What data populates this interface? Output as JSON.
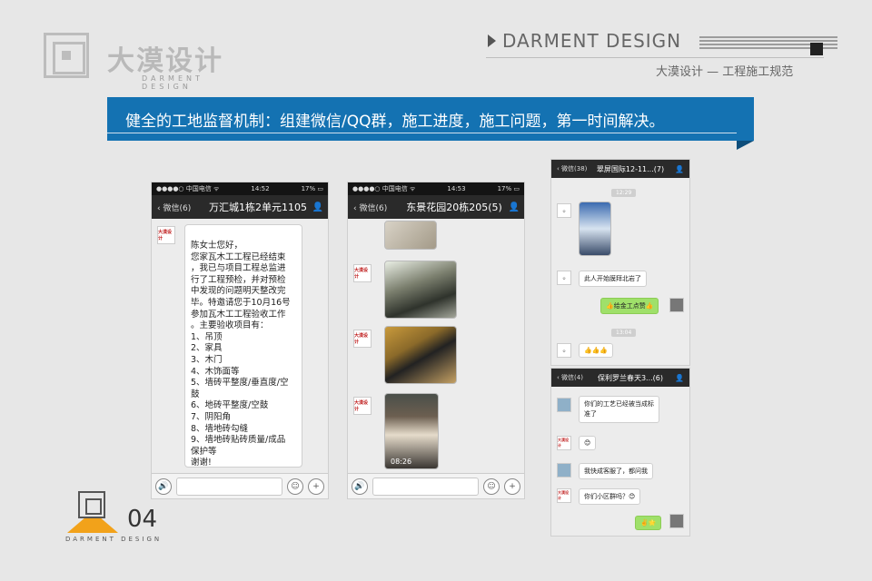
{
  "header": {
    "logo_cn": "大漠设计",
    "logo_en": "DARMENT DESIGN",
    "brand": "DARMENT  DESIGN",
    "subtitle": "大漠设计 — 工程施工规范"
  },
  "banner": {
    "text": "健全的工地监督机制：组建微信/QQ群，施工进度，施工问题，第一时间解决。"
  },
  "phone1": {
    "status": {
      "carrier": "●●●●○ 中国电信 ᯤ",
      "time": "14:52",
      "battery": "17% ▭"
    },
    "back": "微信(6)",
    "title": "万汇城1栋2单元1105",
    "avatar": "大漠设计",
    "message": [
      "陈女士您好，",
      "您家瓦木工工程已经结束",
      "，我已与项目工程总监进",
      "行了工程预检，并对预检",
      "中发现的问题明天整改完",
      "毕。特邀请您于10月16号",
      "参加瓦木工工程验收工作",
      "。主要验收项目有：",
      "1、吊顶",
      "2、家具",
      "3、木门",
      "4、木饰面等",
      "5、墙砖平整度/垂直度/空",
      "鼓",
      "6、地砖平整度/空鼓",
      "7、阴阳角",
      "8、墙地砖勾缝",
      "9、墙地砖贴砖质量/成品",
      "保护等",
      "谢谢!"
    ]
  },
  "phone2": {
    "status": {
      "carrier": "●●●●○ 中国电信 ᯤ",
      "time": "14:53",
      "battery": "17% ▭"
    },
    "back": "微信(6)",
    "title": "东景花园20栋205(5)",
    "avatar": "大漠设计",
    "photo_time": "08:26"
  },
  "phone3a": {
    "back": "微信(38)",
    "title": "翠屏国际12-11...(7)",
    "time_chip1": "12:29",
    "time_chip2": "13:04",
    "msg1": "此人开始膜拜北岩了",
    "msg2": "👍给金工点赞👍",
    "msg3": "👍👍👍"
  },
  "phone3b": {
    "back": "微信(4)",
    "title": "保利罗兰春天3...(6)",
    "avatar": "大漠设计",
    "msg1a": "你们的工艺已经被当成标",
    "msg1b": "准了",
    "msg2": "😊",
    "msg3": "我快成客服了，都问我",
    "msg4": "你们小区群吗？😊",
    "msg5": "✌️🌟"
  },
  "input_icons": {
    "voice": "🔊",
    "emoji": "☺",
    "plus": "+"
  },
  "footer": {
    "page_number": "04",
    "brand": "DARMENT DESIGN"
  },
  "colors": {
    "banner": "#1472b2",
    "accent": "#f2a21a",
    "chat_green": "#9fe06a"
  }
}
